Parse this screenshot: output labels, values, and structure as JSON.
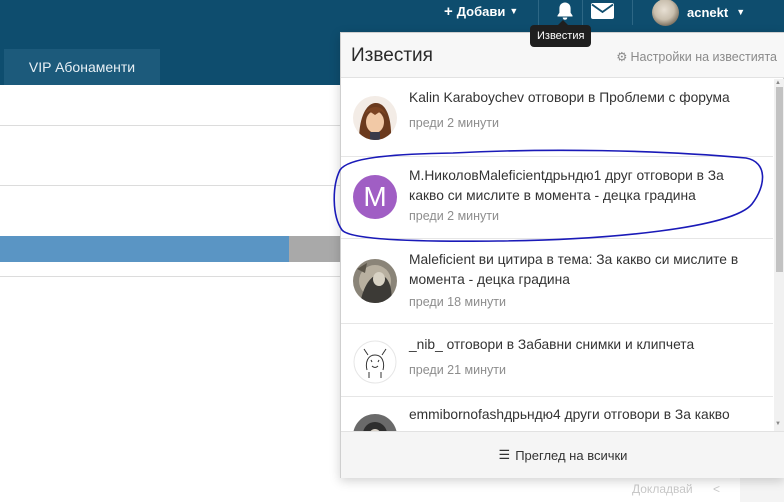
{
  "navbar": {
    "add_label": "Добави",
    "username": "acnekt",
    "bell_tooltip": "Известия",
    "vip_tab": "VIP Абонаменти"
  },
  "notifications": {
    "title": "Известия",
    "settings_label": "Настройки на известията",
    "view_all_label": "Преглед на всички",
    "items": [
      {
        "text": "Kalin Karaboychev отговори в Проблеми с форума",
        "time": "преди 2 минути",
        "avatar": "anime-avatar"
      },
      {
        "text": "М.НиколовMaleficientдрьндю1 друг отговори в За какво си мислите в момента - децка градина",
        "time": "преди 2 минути",
        "avatar": "letter-M",
        "letter": "M"
      },
      {
        "text": "Maleficient ви цитира в тема: За какво си мислите в момента - децка градина",
        "time": "преди 18 минути",
        "avatar": "photo-avatar"
      },
      {
        "text": "_nib_ отговори в Забавни снимки и клипчета",
        "time": "преди 21 минути",
        "avatar": "sketch-avatar"
      },
      {
        "text": "emmibornofashдрьндю4 други отговори в За какво",
        "time": "",
        "avatar": "photo-avatar-2"
      }
    ]
  },
  "background": {
    "footer_text": "Докладвай"
  },
  "colors": {
    "navbar": "#0e4d6e",
    "progress_fill": "#5a95c4",
    "avatar_m": "#a05ec4",
    "annotation": "#1a1ab8"
  }
}
